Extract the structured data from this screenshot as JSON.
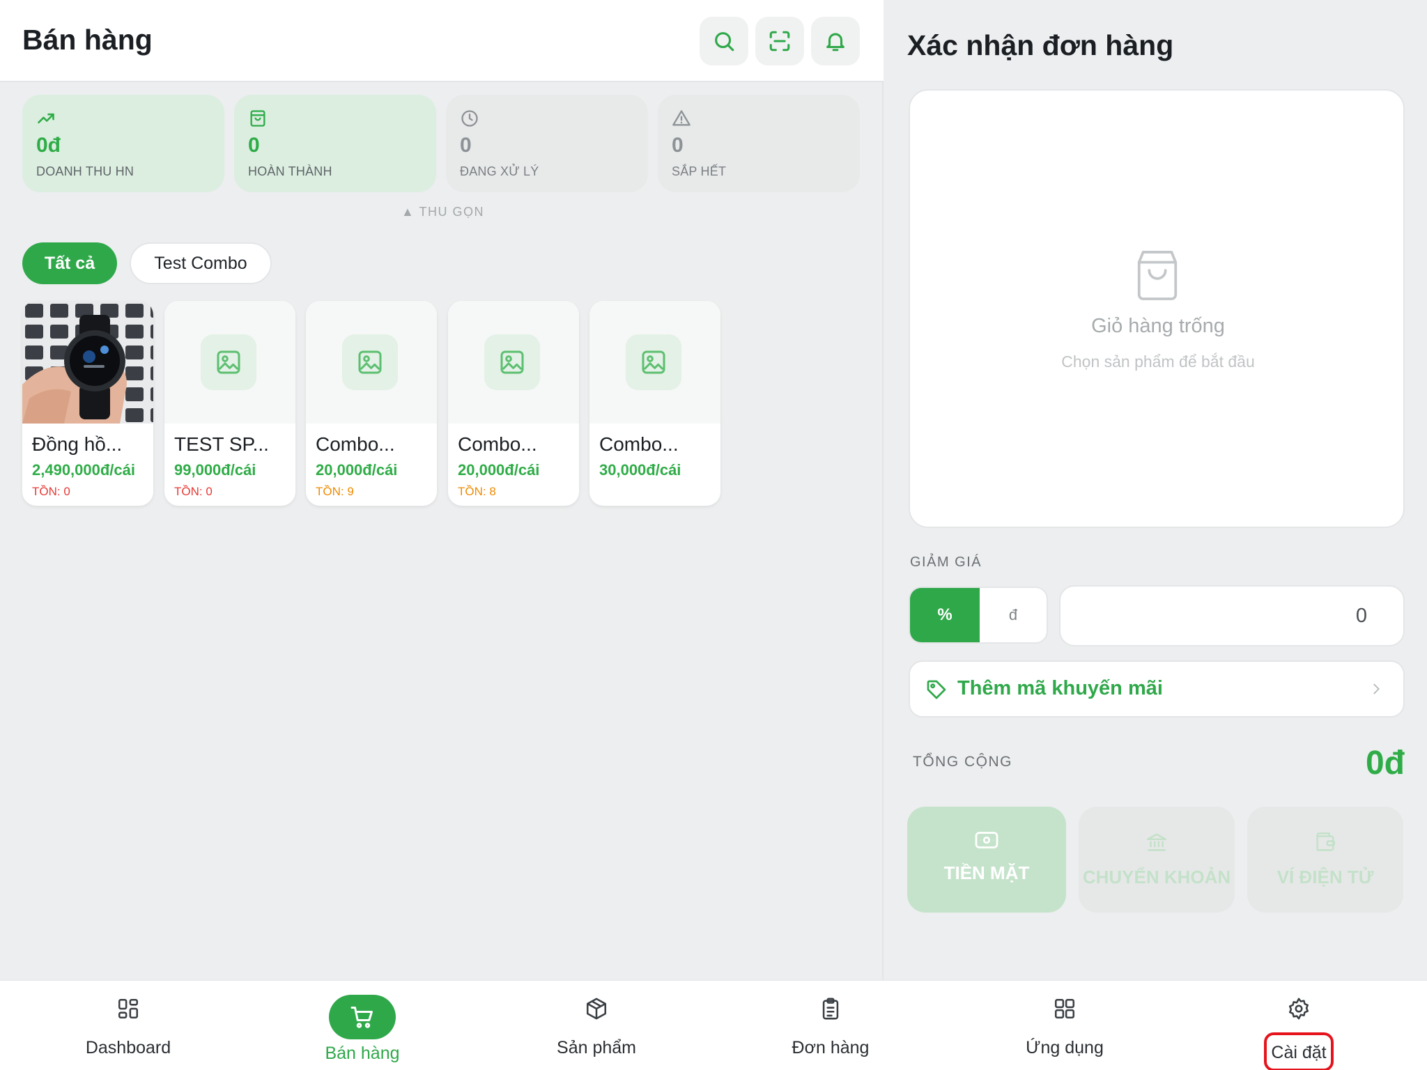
{
  "header": {
    "title": "Bán hàng"
  },
  "stats": [
    {
      "value": "0đ",
      "label": "DOANH THU HN"
    },
    {
      "value": "0",
      "label": "HOÀN THÀNH"
    },
    {
      "value": "0",
      "label": "ĐANG XỬ LÝ"
    },
    {
      "value": "0",
      "label": "SẮP HẾT"
    }
  ],
  "collapse_label": "▲ THU GỌN",
  "categories": [
    "Tất cả",
    "Test Combo"
  ],
  "products": [
    {
      "name": "Đồng hồ...",
      "price": "2,490,000đ/cái",
      "stock": "TỒN: 0",
      "stock_color": "#e53935"
    },
    {
      "name": "TEST SP...",
      "price": "99,000đ/cái",
      "stock": "TỒN: 0",
      "stock_color": "#e53935"
    },
    {
      "name": "Combo...",
      "price": "20,000đ/cái",
      "stock": "TỒN: 9",
      "stock_color": "#f08a00"
    },
    {
      "name": "Combo...",
      "price": "20,000đ/cái",
      "stock": "TỒN: 8",
      "stock_color": "#f08a00"
    },
    {
      "name": "Combo...",
      "price": "30,000đ/cái",
      "stock": ""
    }
  ],
  "order": {
    "title": "Xác nhận đơn hàng",
    "cart_empty": "Giỏ hàng trống",
    "cart_hint": "Chọn sản phẩm để bắt đầu",
    "discount_label": "GIẢM GIÁ",
    "discount_percent": "%",
    "discount_currency": "đ",
    "discount_value": "0",
    "promo_label": "Thêm mã khuyến mãi",
    "total_label": "TỔNG CỘNG",
    "total_value": "0đ",
    "payments": [
      "TIỀN MẶT",
      "CHUYỂN KHOẢN",
      "VÍ ĐIỆN TỬ"
    ]
  },
  "nav": [
    "Dashboard",
    "Bán hàng",
    "Sản phẩm",
    "Đơn hàng",
    "Ứng dụng",
    "Cài đặt"
  ],
  "colors": {
    "accent": "#2fa84a",
    "highlight_outline": "#e5141c"
  }
}
